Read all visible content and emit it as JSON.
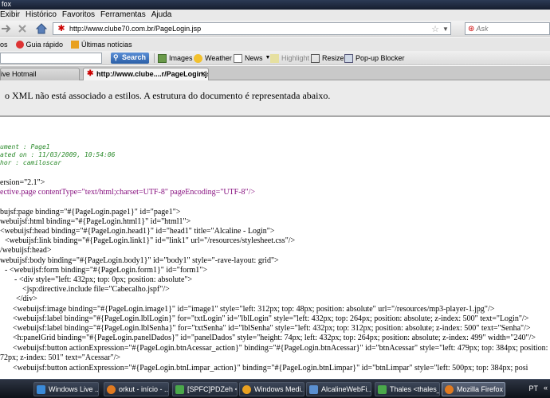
{
  "window": {
    "title_fragment": "fox"
  },
  "menu": [
    "Exibir",
    "Histórico",
    "Favoritos",
    "Ferramentas",
    "Ajuda"
  ],
  "nav": {
    "url": "http://www.clube70.com.br/PageLogin.jsp",
    "search_placeholder": "Ask"
  },
  "bookmarks": [
    "os",
    "Guia rápido",
    "Últimas notícias"
  ],
  "search_toolbar": {
    "search_label": "Search",
    "tools": [
      "Images",
      "Weather",
      "News",
      "Highlight",
      "Resize",
      "Pop-up Blocker"
    ]
  },
  "tabs": {
    "inactive": "ive Hotmail",
    "active": "http://www.clube....r/PageLogin.jsp"
  },
  "infobar": {
    "message": "o XML não está associado a estilos. A estrutura do documento é representada abaixo."
  },
  "code": {
    "comment1": "ument   : Page1",
    "comment2": "ated on : 11/03/2009, 10:54:06",
    "comment3": "hor     : camiloscar",
    "l_version": "ersion=\"2.1\">",
    "l_directive_page": "ective.page contentType=\"text/html;charset=UTF-8\" pageEncoding=\"UTF-8\"/>",
    "l_page": "bujsf:page binding=\"#{PageLogin.page1}\" id=\"page1\">",
    "l_html": "webuijsf:html binding=\"#{PageLogin.html1}\" id=\"html1\">",
    "l_head": "<webuijsf:head binding=\"#{PageLogin.head1}\" id=\"head1\" title=\"Alcaline - Login\">",
    "l_link": "<webuijsf:link binding=\"#{PageLogin.link1}\" id=\"link1\" url=\"/resources/stylesheet.css\"/>",
    "l_head_close": "/webuijsf:head>",
    "l_body": "webuijsf:body binding=\"#{PageLogin.body1}\" id=\"body1\" style=\"-rave-layout: grid\">",
    "l_form": "- <webuijsf:form binding=\"#{PageLogin.form1}\" id=\"form1\">",
    "l_div": "- <div style=\"left: 432px; top: 0px; position: absolute\">",
    "l_include": "<jsp:directive.include file=\"Cabecalho.jspf\"/>",
    "l_div_close": "</div>",
    "l_image": "<webuijsf:image binding=\"#{PageLogin.image1}\" id=\"image1\" style=\"left: 312px; top: 48px; position: absolute\" url=\"/resources/mp3-player-1.jpg\"/>",
    "l_label1": "<webuijsf:label binding=\"#{PageLogin.lblLogin}\" for=\"txtLogin\" id=\"lblLogin\" style=\"left: 432px; top: 264px; position: absolute; z-index: 500\" text=\"Login\"/>",
    "l_label2": "<webuijsf:label binding=\"#{PageLogin.lblSenha}\" for=\"txtSenha\" id=\"lblSenha\" style=\"left: 432px; top: 312px; position: absolute; z-index: 500\" text=\"Senha\"/>",
    "l_panelgrid": "<h:panelGrid binding=\"#{PageLogin.panelDados}\" id=\"panelDados\" style=\"height: 74px; left: 432px; top: 264px; position: absolute; z-index: 499\" width=\"240\"/>",
    "l_button": "<webuijsf:button actionExpression=\"#{PageLogin.btnAcessar_action}\" binding=\"#{PageLogin.btnAcessar}\" id=\"btnAcessar\" style=\"left: 479px; top: 384px; position: absolute",
    "l_button_cont": "72px; z-index: 501\" text=\"Acessar\"/>",
    "l_button2": "<webuijsf:button actionExpression=\"#{PageLogin.btnLimpar_action}\" binding=\"#{PageLogin.btnLimpar}\" id=\"btnLimpar\" style=\"left: 500px; top: 384px; posi"
  },
  "taskbar": {
    "items": [
      "Windows Live ...",
      "orkut - início - ...",
      "[SPFC]PDZeh <...",
      "Windows Medi...",
      "AlcalineWebFi...",
      "Thales <thales_...",
      "Mozilla Firefox"
    ],
    "lang": "PT"
  }
}
